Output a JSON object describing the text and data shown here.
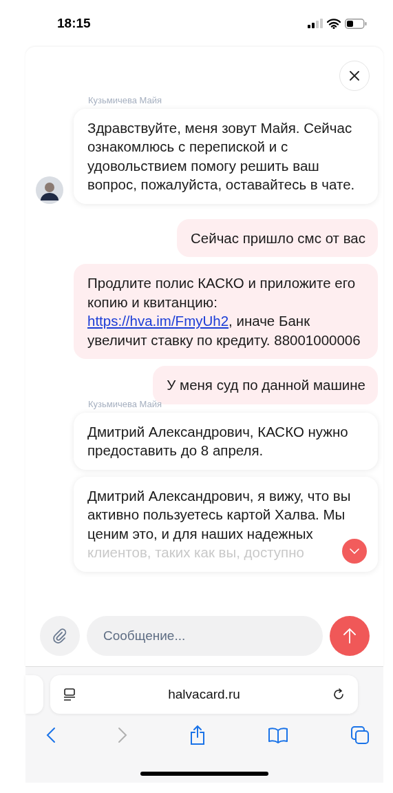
{
  "status_bar": {
    "time": "18:15"
  },
  "chat": {
    "messages": [
      {
        "kind": "operator",
        "sender": "Кузьмичева Майя",
        "avatar": true,
        "text": "Здравствуйте, меня зовут Майя. Сейчас ознакомлюсь с перепиской и с удовольствием помогу решить ваш вопрос, пожалуйста, оставайтесь в чате."
      },
      {
        "kind": "user",
        "text": "Сейчас пришло смс от вас"
      },
      {
        "kind": "user",
        "text": "Продлите полис КАСКО и приложите его копию и квитанцию: ",
        "link": "https://hva.im/FmyUh2",
        "text_after": ", иначе Банк увеличит ставку по кредиту. 88001000006"
      },
      {
        "kind": "user",
        "text": "У меня суд по данной машине"
      },
      {
        "kind": "operator",
        "sender": "Кузьмичева Майя",
        "avatar": false,
        "text": "Дмитрий Александрович, КАСКО нужно предоставить до 8 апреля."
      },
      {
        "kind": "operator",
        "avatar": false,
        "text": "Дмитрий Александрович, я вижу, что вы активно пользуетесь картой Халва. Мы ценим это, и для наших надежных",
        "faded_text": "клиентов, таких как вы, доступно"
      }
    ]
  },
  "composer": {
    "placeholder": "Сообщение..."
  },
  "browser": {
    "url": "halvacard.ru"
  }
}
